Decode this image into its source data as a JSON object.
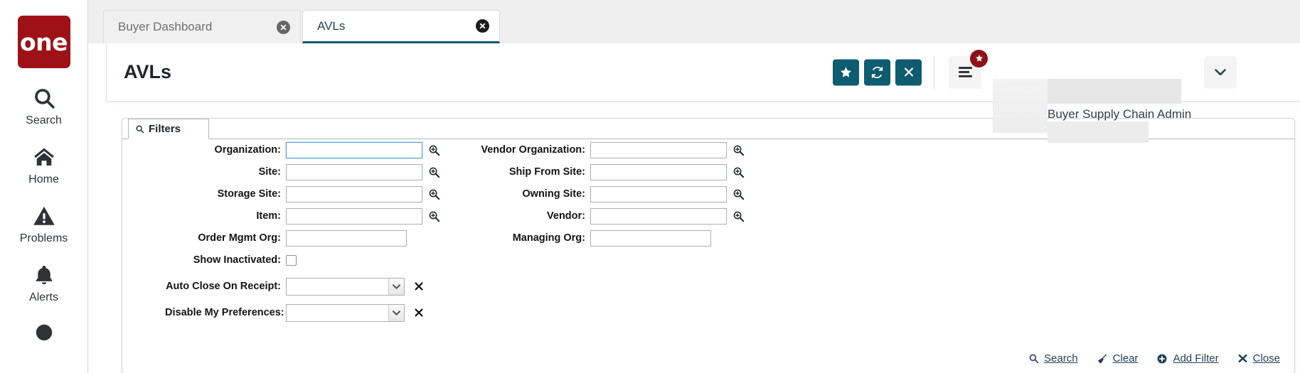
{
  "brand": {
    "logo_text": "one",
    "logo_color": "#9e1217",
    "accent_teal": "#0d5c70"
  },
  "sidebar": {
    "items": [
      {
        "label": "Search",
        "icon": "search-icon"
      },
      {
        "label": "Home",
        "icon": "home-icon"
      },
      {
        "label": "Problems",
        "icon": "warning-triangle-icon"
      },
      {
        "label": "Alerts",
        "icon": "bell-icon"
      }
    ]
  },
  "tabs": [
    {
      "label": "Buyer Dashboard",
      "active": false
    },
    {
      "label": "AVLs",
      "active": true
    }
  ],
  "header": {
    "title": "AVLs",
    "buttons": [
      {
        "name": "favorite-button",
        "icon": "star-icon"
      },
      {
        "name": "refresh-button",
        "icon": "refresh-icon"
      },
      {
        "name": "close-button",
        "icon": "x-icon"
      }
    ],
    "menu_icon": "hamburger-menu-icon",
    "menu_badge_icon": "star-icon",
    "user_name": "Buyer Supply Chain Admin",
    "user_caret_icon": "chevron-down-icon"
  },
  "filters": {
    "tab_label": "Filters",
    "tab_icon": "search-icon",
    "left_fields": [
      {
        "label": "Organization:",
        "value": "",
        "type": "lookup",
        "focused": true,
        "icon": "magnifier-plus-icon"
      },
      {
        "label": "Site:",
        "value": "",
        "type": "lookup",
        "focused": false,
        "icon": "magnifier-plus-icon"
      },
      {
        "label": "Storage Site:",
        "value": "",
        "type": "lookup",
        "focused": false,
        "icon": "magnifier-plus-icon"
      },
      {
        "label": "Item:",
        "value": "",
        "type": "lookup",
        "focused": false,
        "icon": "magnifier-plus-icon"
      },
      {
        "label": "Order Mgmt Org:",
        "value": "",
        "type": "text",
        "focused": false,
        "icon": ""
      },
      {
        "label": "Show Inactivated:",
        "value": "",
        "type": "checkbox",
        "checked": false,
        "icon": ""
      },
      {
        "label": "Auto Close On Receipt:",
        "value": "",
        "type": "select",
        "icon": "chevron-down-icon",
        "remove_icon": "x-icon"
      },
      {
        "label": "Disable My Preferences:",
        "value": "",
        "type": "select",
        "icon": "chevron-down-icon",
        "remove_icon": "x-icon"
      }
    ],
    "right_fields": [
      {
        "label": "Vendor Organization:",
        "value": "",
        "type": "lookup",
        "icon": "magnifier-plus-icon"
      },
      {
        "label": "Ship From Site:",
        "value": "",
        "type": "lookup",
        "icon": "magnifier-plus-icon"
      },
      {
        "label": "Owning Site:",
        "value": "",
        "type": "lookup",
        "icon": "magnifier-plus-icon"
      },
      {
        "label": "Vendor:",
        "value": "",
        "type": "lookup",
        "icon": "magnifier-plus-icon"
      },
      {
        "label": "Managing Org:",
        "value": "",
        "type": "text",
        "icon": ""
      }
    ],
    "actions": [
      {
        "label": "Search",
        "icon": "search-icon"
      },
      {
        "label": "Clear",
        "icon": "broom-icon"
      },
      {
        "label": "Add Filter",
        "icon": "plus-circle-icon"
      },
      {
        "label": "Close",
        "icon": "x-icon"
      }
    ]
  }
}
